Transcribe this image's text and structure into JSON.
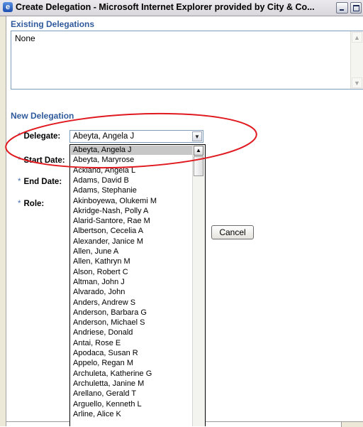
{
  "window": {
    "title": "Create Delegation - Microsoft Internet Explorer provided by City & Co..."
  },
  "existing": {
    "title": "Existing Delegations",
    "value": "None"
  },
  "new_delegation": {
    "title": "New Delegation",
    "required_mark": "*",
    "fields": {
      "delegate": "Delegate:",
      "start_date": "Start Date:",
      "end_date": "End Date:",
      "role": "Role:"
    },
    "delegate_value": "Abeyta, Angela J"
  },
  "buttons": {
    "cancel": "Cancel"
  },
  "dropdown": {
    "options": [
      "Abeyta, Angela J",
      "Abeyta, Maryrose",
      "Ackland, Angela L",
      "Adams, David B",
      "Adams, Stephanie",
      "Akinboyewa, Olukemi M",
      "Akridge-Nash, Polly A",
      "Alarid-Santore, Rae M",
      "Albertson, Cecelia A",
      "Alexander, Janice M",
      "Allen, June A",
      "Allen, Kathryn M",
      "Alson, Robert C",
      "Altman, John J",
      "Alvarado, John",
      "Anders, Andrew S",
      "Anderson, Barbara G",
      "Anderson, Michael S",
      "Andriese, Donald",
      "Antai, Rose E",
      "Apodaca, Susan R",
      "Appelo, Regan M",
      "Archuleta, Katherine G",
      "Archuletta, Janine M",
      "Arellano, Gerald T",
      "Arguello, Kenneth L",
      "Arline, Alice K"
    ],
    "selected_index": 0
  },
  "colors": {
    "section_title": "#2f5a9c",
    "annotation": "#e0191f",
    "selected_option": "#c7c7c7"
  }
}
